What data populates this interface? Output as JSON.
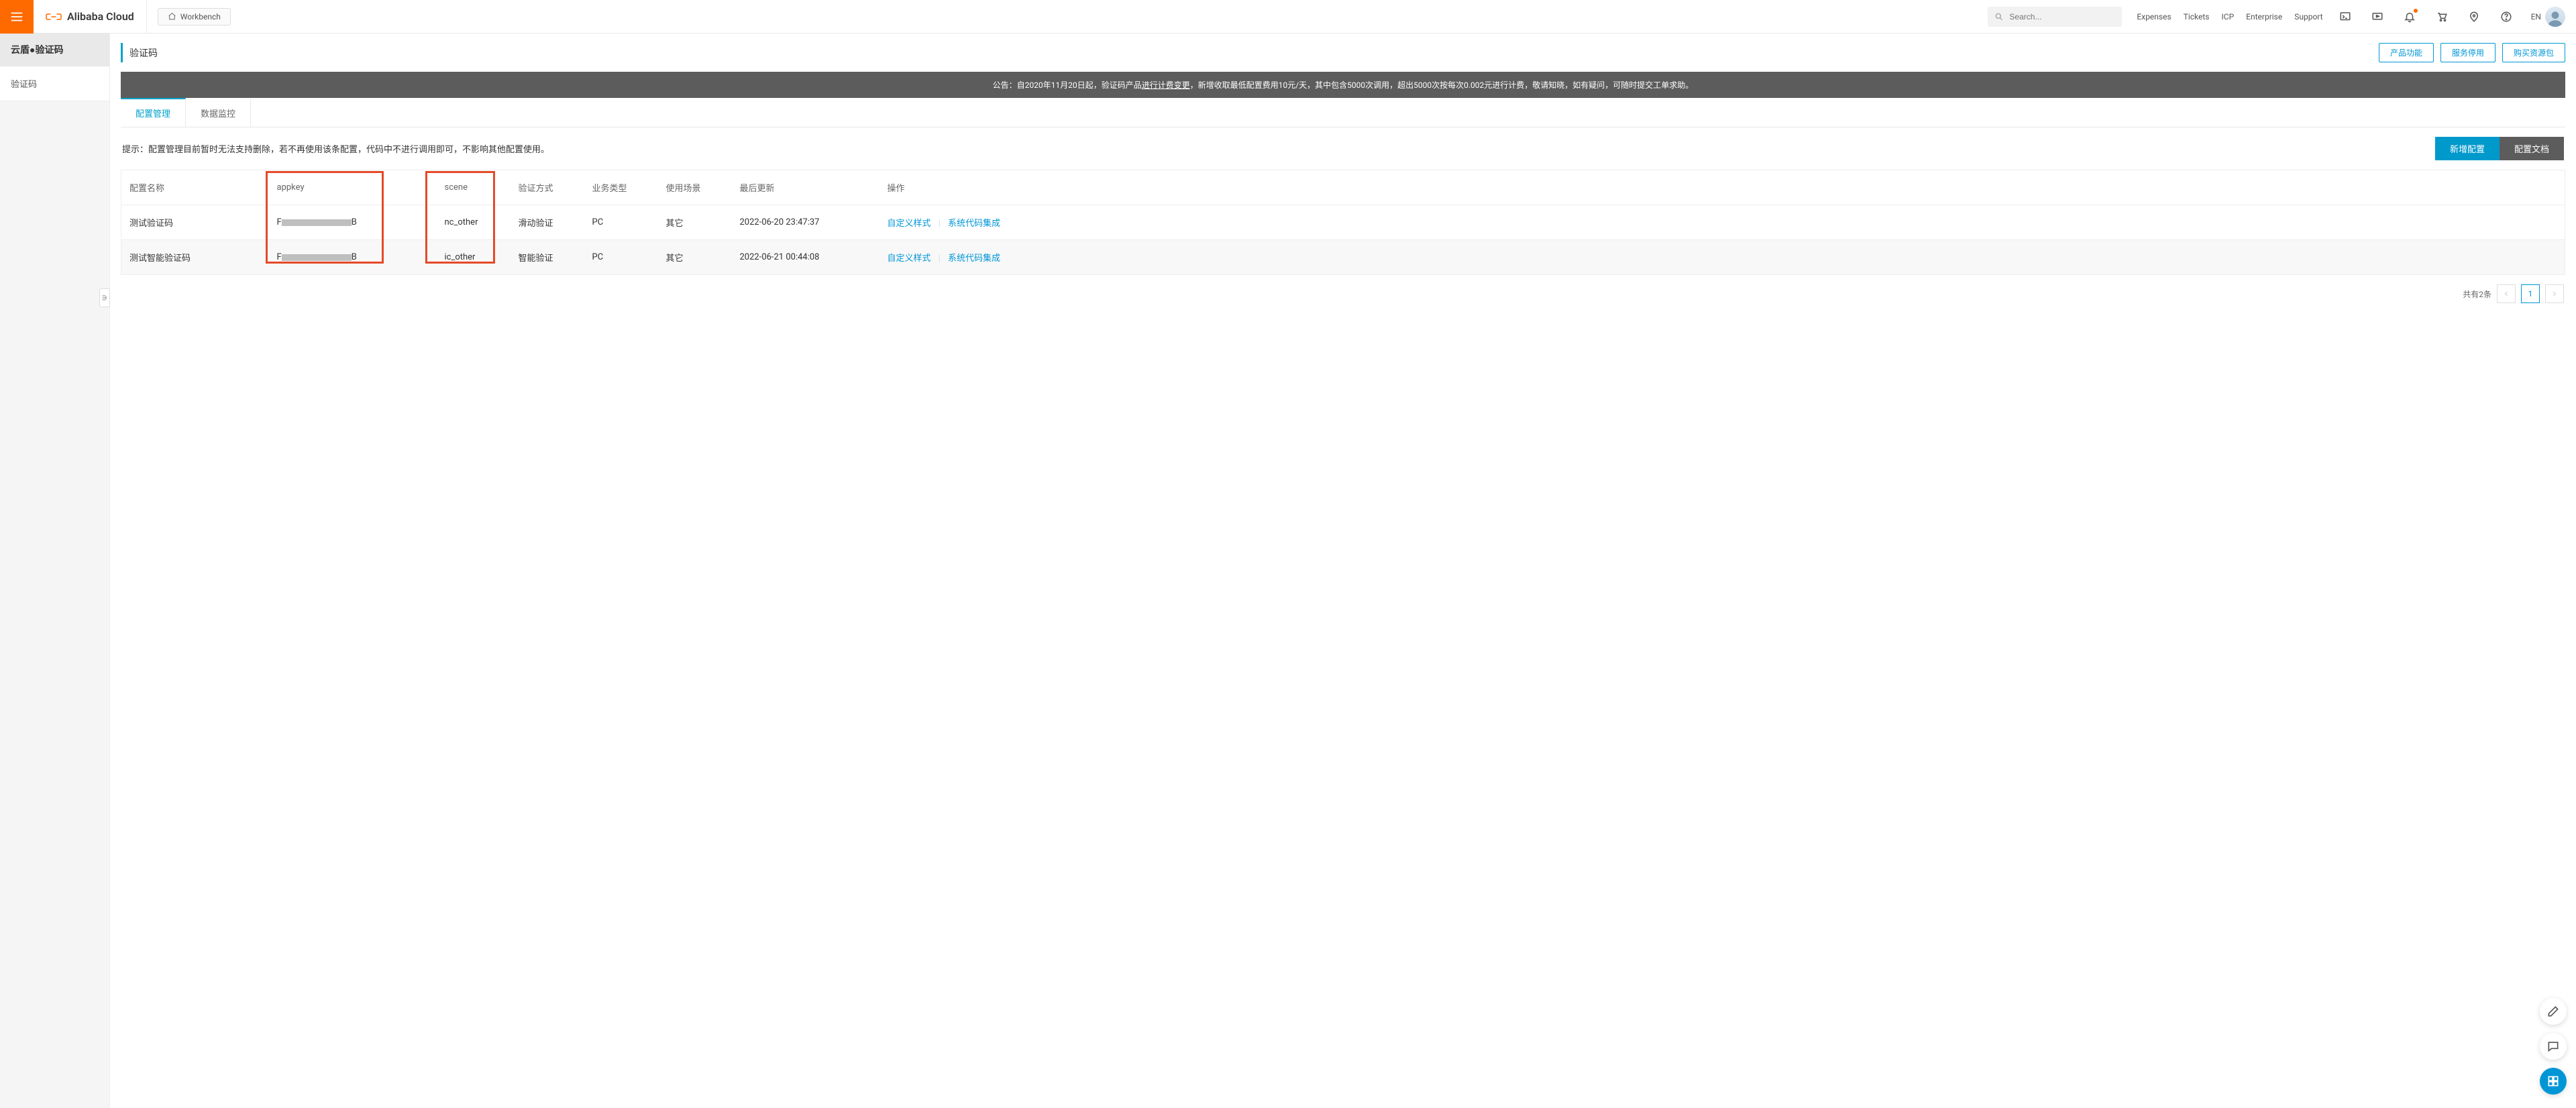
{
  "header": {
    "brand_text": "Alibaba Cloud",
    "workbench": "Workbench",
    "search_placeholder": "Search...",
    "nav": {
      "expenses": "Expenses",
      "tickets": "Tickets",
      "icp": "ICP",
      "enterprise": "Enterprise",
      "support": "Support"
    },
    "lang": "EN"
  },
  "sidebar": {
    "title": "云盾●验证码",
    "item": "验证码"
  },
  "page": {
    "title": "验证码",
    "actions": {
      "product_feature": "产品功能",
      "service_stop": "服务停用",
      "buy_resource": "购买资源包"
    },
    "announce_prefix": "公告：自2020年11月20日起，验证码产品",
    "announce_underlined": "进行计费变更",
    "announce_suffix": "，新增收取最低配置费用10元/天，其中包含5000次调用，超出5000次按每次0.002元进行计费，敬请知晓，如有疑问，可随时提交工单求助。",
    "tabs": {
      "config": "配置管理",
      "monitor": "数据监控"
    },
    "tip_text": "提示：配置管理目前暂时无法支持删除，若不再使用该条配置，代码中不进行调用即可，不影响其他配置使用。",
    "tip_actions": {
      "new_config": "新增配置",
      "config_doc": "配置文档"
    },
    "table": {
      "columns": {
        "name": "配置名称",
        "appkey": "appkey",
        "scene": "scene",
        "verify_method": "验证方式",
        "biz_type": "业务类型",
        "use_case": "使用场景",
        "last_update": "最后更新",
        "ops": "操作"
      },
      "rows": [
        {
          "name": "测试验证码",
          "appkey_prefix": "F",
          "appkey_suffix": "B",
          "scene": "nc_other",
          "verify_method": "滑动验证",
          "biz_type": "PC",
          "use_case": "其它",
          "last_update": "2022-06-20 23:47:37"
        },
        {
          "name": "测试智能验证码",
          "appkey_prefix": "F",
          "appkey_suffix": "B",
          "scene": "ic_other",
          "verify_method": "智能验证",
          "biz_type": "PC",
          "use_case": "其它",
          "last_update": "2022-06-21 00:44:08"
        }
      ],
      "ops": {
        "custom_style": "自定义样式",
        "sdk_integration": "系统代码集成"
      }
    },
    "pager": {
      "total_text": "共有2条",
      "current": "1"
    }
  }
}
